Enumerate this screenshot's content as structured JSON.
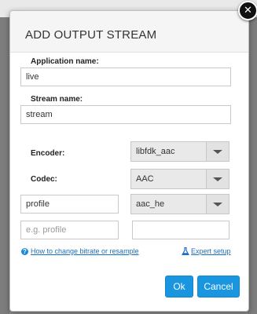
{
  "dialog": {
    "title": "ADD OUTPUT STREAM",
    "close_glyph": "✕"
  },
  "application": {
    "label": "Application name:",
    "value": "live"
  },
  "stream": {
    "label": "Stream name:",
    "value": "stream"
  },
  "encoder": {
    "label": "Encoder:",
    "value": "libfdk_aac"
  },
  "codec": {
    "label": "Codec:",
    "value": "AAC"
  },
  "param_row_1": {
    "name_value": "profile",
    "option_value": "aac_he"
  },
  "param_row_2": {
    "name_placeholder": "e.g. profile",
    "value": ""
  },
  "links": {
    "help_text": "How to change bitrate or resample",
    "expert_text": "Expert setup"
  },
  "buttons": {
    "ok": "Ok",
    "cancel": "Cancel"
  },
  "colors": {
    "accent": "#1a95e0",
    "link": "#1b6fbf"
  },
  "icons": [
    "close-icon",
    "help-icon",
    "flask-icon",
    "chevron-down-icon"
  ]
}
